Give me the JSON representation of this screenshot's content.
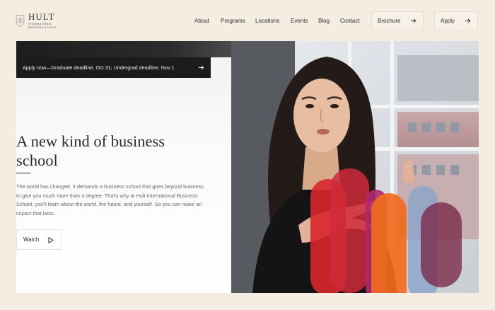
{
  "brand": {
    "name": "HULT",
    "subtitle": "INTERNATIONAL BUSINESS SCHOOL"
  },
  "nav": {
    "links": [
      "About",
      "Programs",
      "Locations",
      "Events",
      "Blog",
      "Contact"
    ],
    "brochure_label": "Brochure",
    "apply_label": "Apply"
  },
  "banner": {
    "text": "Apply now—Graduate deadline, Oct 31; Undergrad deadline, Nov 1"
  },
  "hero": {
    "headline": "A new kind of business school",
    "body": "The world has changed. It demands a business school that goes beyond business to give you much more than a degree. That's why at Hult International Business School, you'll learn about the world, the future, and yourself. So you can make an impact that lasts.",
    "watch_label": "Watch"
  },
  "colors": {
    "background": "#f6ede2",
    "dark": "#1c1c1c",
    "shape_red": "#d8262b",
    "shape_orange": "#f26b1d",
    "shape_magenta": "#b0286e",
    "shape_blue": "#8aa4c8",
    "shape_plum": "#7a2a4a"
  },
  "icons": {
    "arrow": "arrow-right-icon",
    "play": "play-icon",
    "logo": "shield-leaf-icon"
  }
}
